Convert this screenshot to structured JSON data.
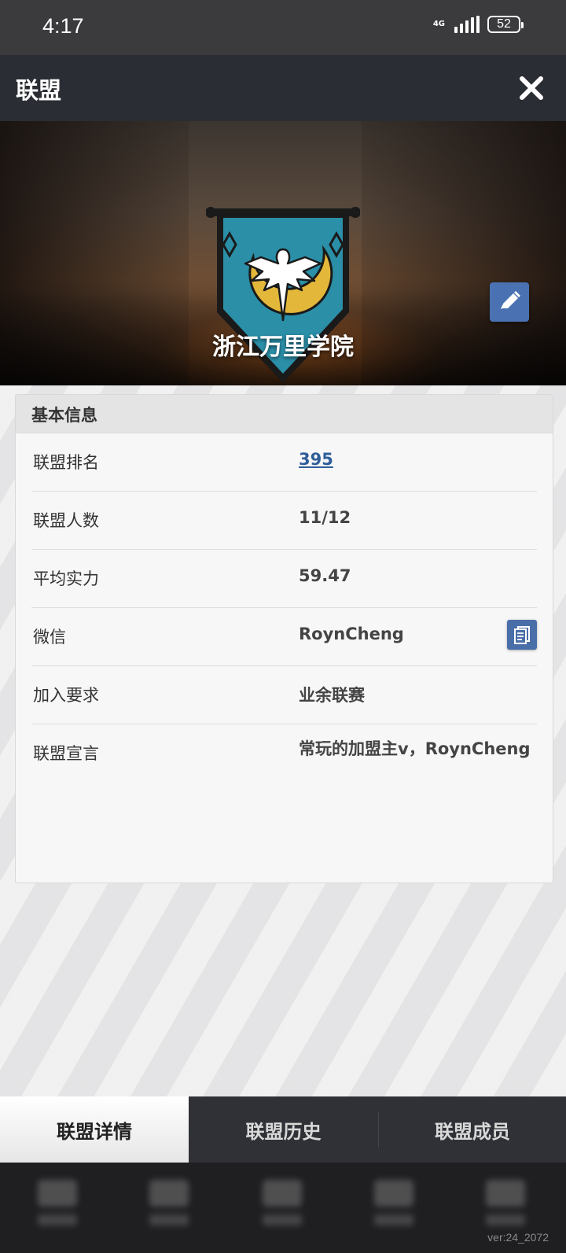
{
  "status_bar": {
    "time": "4:17",
    "network": "4G",
    "battery": "52"
  },
  "header": {
    "title": "联盟"
  },
  "banner": {
    "team_name": "浙江万里学院"
  },
  "info": {
    "section_title": "基本信息",
    "rows": [
      {
        "label": "联盟排名",
        "value": "395"
      },
      {
        "label": "联盟人数",
        "value": "11/12"
      },
      {
        "label": "平均实力",
        "value": "59.47"
      },
      {
        "label": "微信",
        "value": "RoynCheng"
      },
      {
        "label": "加入要求",
        "value": "业余联赛"
      },
      {
        "label": "联盟宣言",
        "value": "常玩的加盟主v，RoynCheng"
      }
    ]
  },
  "tabs": [
    {
      "label": "联盟详情",
      "active": true
    },
    {
      "label": "联盟历史",
      "active": false
    },
    {
      "label": "联盟成员",
      "active": false
    }
  ],
  "footer": {
    "version": "ver:24_2072"
  },
  "colors": {
    "accent": "#4a72b2",
    "link": "#2e5e99",
    "header_bg": "#2a2d33",
    "crest_teal": "#2b8fa8",
    "crest_gold": "#e3b73a"
  }
}
